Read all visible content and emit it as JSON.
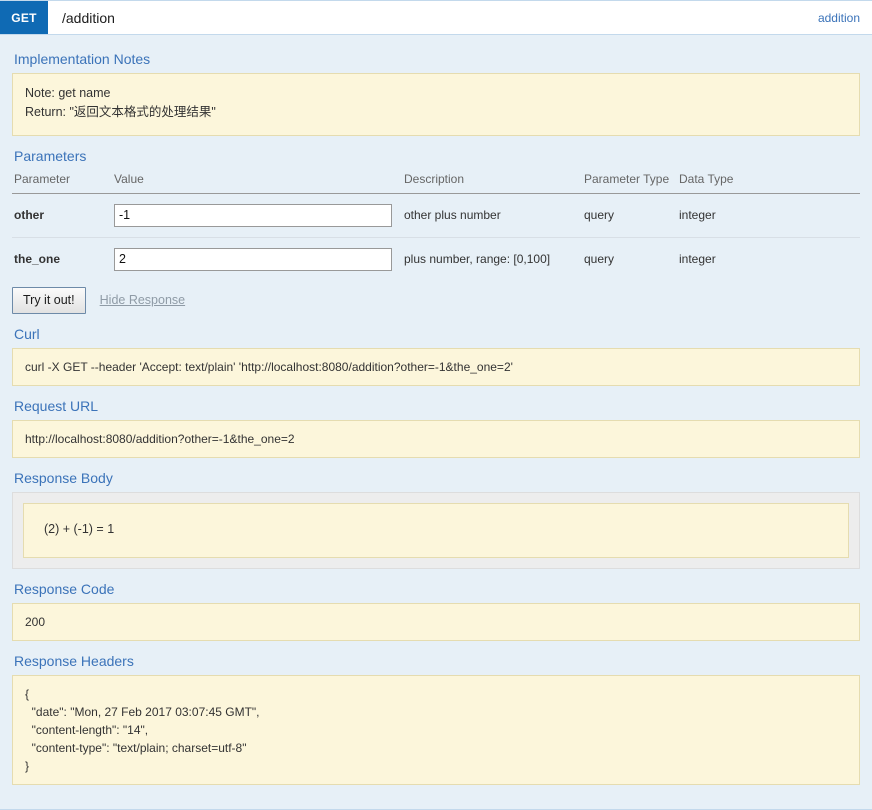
{
  "operation": {
    "method": "GET",
    "path": "/addition",
    "tag": "addition"
  },
  "sections": {
    "implementation_notes_title": "Implementation Notes",
    "implementation_notes_body": "Note: get name\nReturn: \"返回文本格式的处理结果\"",
    "parameters_title": "Parameters",
    "curl_title": "Curl",
    "curl_command": "curl -X GET --header 'Accept: text/plain' 'http://localhost:8080/addition?other=-1&the_one=2'",
    "request_url_title": "Request URL",
    "request_url": "http://localhost:8080/addition?other=-1&the_one=2",
    "response_body_title": "Response Body",
    "response_body": "(2) + (-1) = 1",
    "response_code_title": "Response Code",
    "response_code": "200",
    "response_headers_title": "Response Headers",
    "response_headers": "{\n  \"date\": \"Mon, 27 Feb 2017 03:07:45 GMT\",\n  \"content-length\": \"14\",\n  \"content-type\": \"text/plain; charset=utf-8\"\n}"
  },
  "parameters": {
    "columns": [
      "Parameter",
      "Value",
      "Description",
      "Parameter Type",
      "Data Type"
    ],
    "rows": [
      {
        "name": "other",
        "value": "-1",
        "placeholder": "",
        "description": "other plus number",
        "param_type": "query",
        "data_type": "integer"
      },
      {
        "name": "the_one",
        "value": "2",
        "placeholder": "",
        "description": "plus number, range: [0,100]",
        "param_type": "query",
        "data_type": "integer"
      }
    ]
  },
  "actions": {
    "try_it_out": "Try it out!",
    "toggle_response": "Hide Response"
  },
  "colors": {
    "method_get": "#0f6ab4",
    "heading_link": "#3b73b9",
    "panel_background": "#e7f0f7",
    "code_block": "#fcf6db"
  }
}
